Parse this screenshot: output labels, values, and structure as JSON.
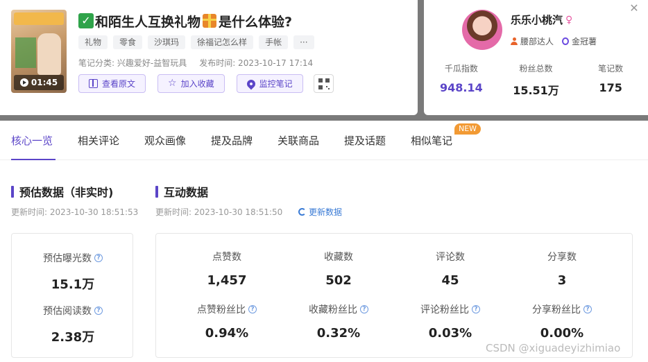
{
  "note": {
    "duration": "01:45",
    "title": "和陌生人互换礼物",
    "title_suffix": "是什么体验?",
    "tags": [
      "礼物",
      "零食",
      "沙琪玛",
      "徐福记怎么样",
      "手帐",
      "···"
    ],
    "category": "笔记分类: 兴趣爱好-益智玩具",
    "publish_time": "发布时间:  2023-10-17 17:14",
    "actions": {
      "view_original": "查看原文",
      "add_favorite": "加入收藏",
      "monitor_note": "监控笔记"
    }
  },
  "user": {
    "name": "乐乐小桃汽",
    "gender_symbol": "♀",
    "tags": [
      "腰部达人",
      "金冠薯"
    ],
    "stats": [
      {
        "label": "千瓜指数",
        "value": "948.14"
      },
      {
        "label": "粉丝总数",
        "value": "15.51万"
      },
      {
        "label": "笔记数",
        "value": "175"
      }
    ]
  },
  "tabs": [
    "核心一览",
    "相关评论",
    "观众画像",
    "提及品牌",
    "关联商品",
    "提及话题",
    "相似笔记"
  ],
  "new_badge": "NEW",
  "estimate": {
    "title": "预估数据（非实时)",
    "updated": "更新时间:  2023-10-30 18:51:53",
    "metrics": [
      {
        "label": "预估曝光数",
        "value": "15.1万"
      },
      {
        "label": "预估阅读数",
        "value": "2.38万"
      }
    ]
  },
  "interaction": {
    "title": "互动数据",
    "updated": "更新时间:  2023-10-30 18:51:50",
    "refresh": "更新数据",
    "metrics": [
      {
        "label": "点赞数",
        "value": "1,457"
      },
      {
        "label": "收藏数",
        "value": "502"
      },
      {
        "label": "评论数",
        "value": "45"
      },
      {
        "label": "分享数",
        "value": "3"
      },
      {
        "label": "点赞粉丝比",
        "value": "0.94%"
      },
      {
        "label": "收藏粉丝比",
        "value": "0.32%"
      },
      {
        "label": "评论粉丝比",
        "value": "0.03%"
      },
      {
        "label": "分享粉丝比",
        "value": "0.00%"
      }
    ]
  },
  "watermark": "CSDN @xiguadeyizhimiao",
  "colors": {
    "accent": "#5b45c8",
    "link": "#3a7bd5",
    "badge": "#f29a34"
  }
}
